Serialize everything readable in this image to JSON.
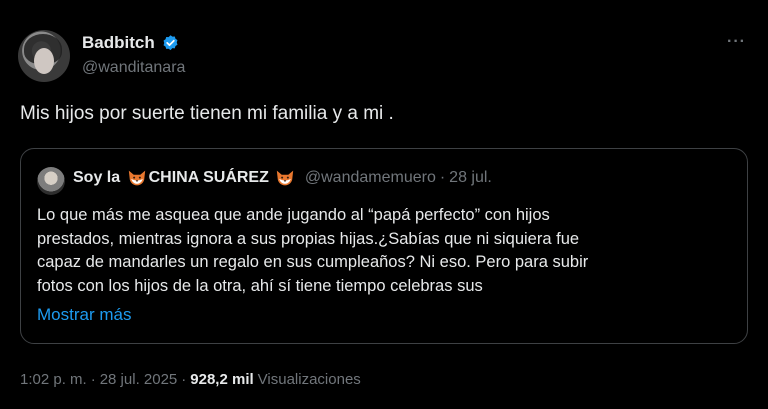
{
  "author": {
    "display_name": "Badbitch",
    "handle": "@wanditanara"
  },
  "more_label": "···",
  "tweet": {
    "text": "Mis hijos por suerte tienen mi familia y a mi ."
  },
  "quoted": {
    "name_prefix": "Soy la ",
    "name_main": "CHINA SUÁREZ",
    "handle": "@wandamemuero",
    "separator": "·",
    "date": "28 jul.",
    "lines": [
      "Lo que más me asquea que ande jugando al “papá perfecto” con hijos",
      "prestados, mientras ignora a sus propias hijas.¿Sabías que ni siquiera fue",
      "capaz de mandarles un regalo en sus cumpleaños? Ni eso. Pero para subir",
      "fotos con los hijos de la otra, ahí sí tiene tiempo celebras sus"
    ],
    "show_more": "Mostrar más"
  },
  "meta": {
    "time": "1:02 p. m.",
    "sep1": "·",
    "date": "28 jul. 2025",
    "sep2": "·",
    "views_count": "928,2 mil",
    "views_label": "Visualizaciones"
  },
  "colors": {
    "background": "#000000",
    "text": "#e7e9ea",
    "muted": "#71767b",
    "accent": "#1d9bf0",
    "border": "#3e4144"
  }
}
